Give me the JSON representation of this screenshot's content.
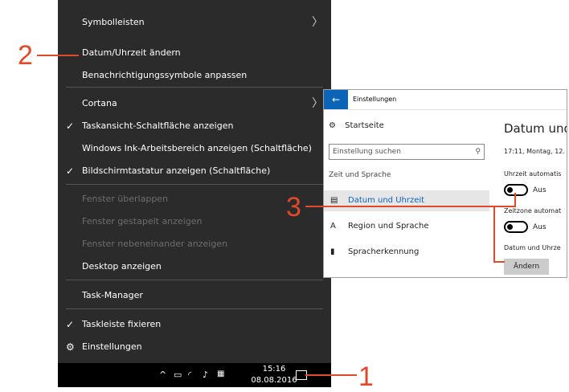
{
  "context_menu": {
    "items": [
      {
        "label": "Symbolleisten",
        "checked": false,
        "disabled": false,
        "submenu": true
      },
      {
        "label": "Datum/Uhrzeit ändern",
        "checked": false,
        "disabled": false,
        "submenu": false
      },
      {
        "label": "Benachrichtigungssymbole anpassen",
        "checked": false,
        "disabled": false,
        "submenu": false
      },
      {
        "label": "Cortana",
        "checked": false,
        "disabled": false,
        "submenu": true
      },
      {
        "label": "Taskansicht-Schaltfläche anzeigen",
        "checked": true,
        "disabled": false,
        "submenu": false
      },
      {
        "label": "Windows Ink-Arbeitsbereich anzeigen (Schaltfläche)",
        "checked": false,
        "disabled": false,
        "submenu": false
      },
      {
        "label": "Bildschirmtastatur anzeigen (Schaltfläche)",
        "checked": true,
        "disabled": false,
        "submenu": false
      },
      {
        "label": "Fenster überlappen",
        "checked": false,
        "disabled": true,
        "submenu": false
      },
      {
        "label": "Fenster gestapelt anzeigen",
        "checked": false,
        "disabled": true,
        "submenu": false
      },
      {
        "label": "Fenster nebeneinander anzeigen",
        "checked": false,
        "disabled": true,
        "submenu": false
      },
      {
        "label": "Desktop anzeigen",
        "checked": false,
        "disabled": false,
        "submenu": false
      },
      {
        "label": "Task-Manager",
        "checked": false,
        "disabled": false,
        "submenu": false
      },
      {
        "label": "Taskleiste fixieren",
        "checked": true,
        "disabled": false,
        "submenu": false
      },
      {
        "label": "Einstellungen",
        "checked": false,
        "disabled": false,
        "submenu": false,
        "icon": "gear-icon"
      }
    ],
    "check_glyph": "✓",
    "submenu_glyph": "〉",
    "gear_glyph": "⚙"
  },
  "taskbar": {
    "time": "15:16",
    "date": "08.08.2016",
    "icons": [
      "chevron-up-icon",
      "battery-icon",
      "wifi-icon",
      "volume-icon",
      "keyboard-icon",
      "notification-icon"
    ]
  },
  "callouts": {
    "one": "1",
    "two": "2",
    "three": "3"
  },
  "settings_window": {
    "title": "Einstellungen",
    "back_glyph": "←",
    "home_label": "Startseite",
    "search_placeholder": "Einstellung suchen",
    "group_label": "Zeit und Sprache",
    "nav_items": [
      {
        "label": "Datum und Uhrzeit",
        "selected": true,
        "icon": "calendar-icon"
      },
      {
        "label": "Region und Sprache",
        "selected": false,
        "icon": "language-icon"
      },
      {
        "label": "Spracherkennung",
        "selected": false,
        "icon": "microphone-icon"
      }
    ],
    "main": {
      "heading": "Datum und",
      "current_datetime": "17:11, Montag, 12.",
      "auto_time_label": "Uhrzeit automatis",
      "auto_time_state": "Aus",
      "auto_zone_label": "Zeitzone automat",
      "auto_zone_state": "Aus",
      "change_label": "Datum und Uhrze",
      "change_button": "Ändern"
    }
  },
  "colors": {
    "accent": "#0a64b8",
    "callout": "#e04a2a",
    "menu_bg": "#2b2b2b"
  }
}
